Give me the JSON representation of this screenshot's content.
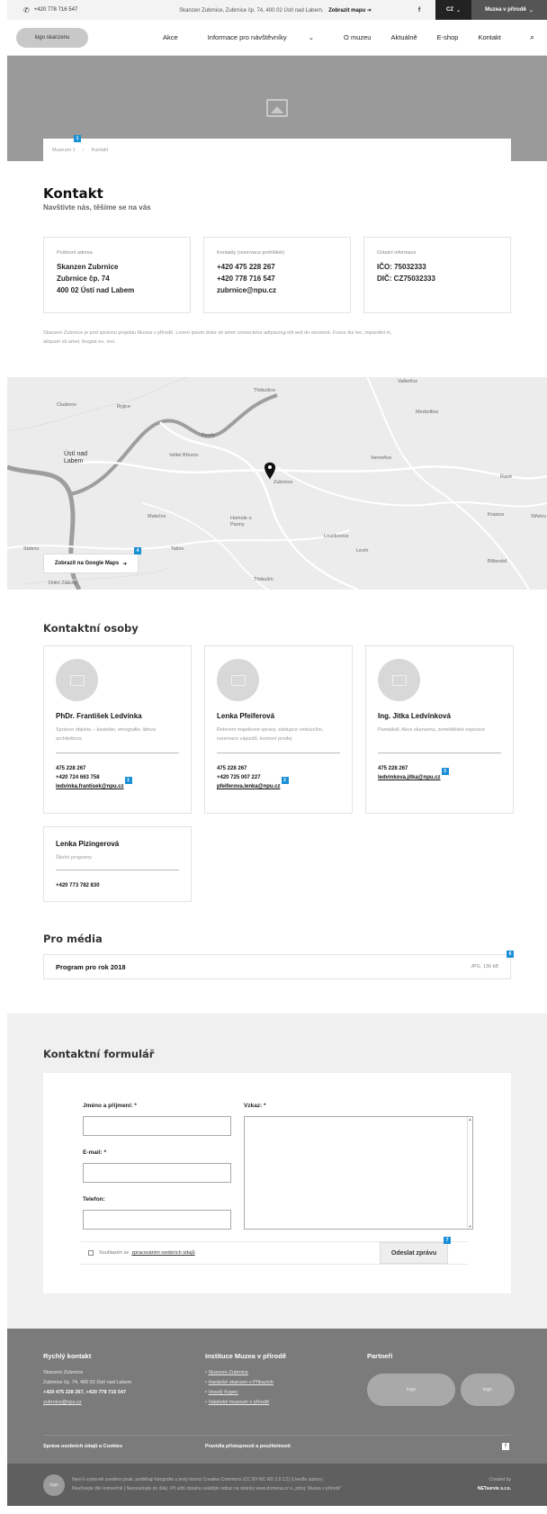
{
  "topbar": {
    "phone": "+420 778 716 547",
    "address": "Skanzen Zubrnice, Zubrnice čp. 74, 400 02 Ústí nad Labem.",
    "map_link": "Zobrazit mapu",
    "facebook": "f",
    "lang": "CZ",
    "museums": "Muzea v přírodě"
  },
  "nav": {
    "logo": "logo skanzenu",
    "items": [
      "Akce",
      "Informace pro návštěvníky",
      "O muzeu",
      "Aktuálně",
      "E-shop",
      "Kontakt"
    ]
  },
  "breadcrumb": {
    "home": "Muzeum 1",
    "current": "Kontakt"
  },
  "page": {
    "title": "Kontakt",
    "subtitle": "Navštivte nás, těšíme se na vás"
  },
  "info": [
    {
      "label": "Poštovní adresa",
      "lines": [
        "Skanzen Zubrnice",
        "Zubrnice čp. 74",
        "400 02 Ústí nad Labem"
      ]
    },
    {
      "label": "Kontakty (rezervace prohlídek)",
      "lines": [
        "+420 475 228 267",
        "+420 778 716 547",
        "zubrnice@npu.cz"
      ]
    },
    {
      "label": "Ostatní informace",
      "lines": [
        "IČO: 75032333",
        "DIČ: CZ75032333"
      ]
    }
  ],
  "note": "Skanzen Zubrnice je pod správou projektu Muzea v přírodě. Lorem ipsum dolor sit amet consectetur adipiscing elit sed do eiusmod. Fusce dui leo, imperdiet in, aliquam sit amet, feugiat eu, orci.",
  "map": {
    "labels": [
      "Třebušice",
      "Valkeřice",
      "Cluderov",
      "Ryjice",
      "Merboltice",
      "Povrly",
      "Ústí nad Labem",
      "Velké Březno",
      "Verneřice",
      "Zubrnice",
      "Malečov",
      "Homole u Panny",
      "Řané",
      "Krasice",
      "Střelov",
      "Loučkovice",
      "Levín",
      "Stebno",
      "Tašov",
      "Bílkevěd",
      "Dolní Zálezly",
      "Třebušín"
    ],
    "button": "Zobrazit na Google Maps"
  },
  "persons_title": "Kontaktní osoby",
  "persons": [
    {
      "name": "PhDr. František Ledvinka",
      "role": "Správce objektu – kastelán, etnografie, lidová architektura",
      "phones": [
        "475 228 267",
        "+420 724 663 758"
      ],
      "email": "ledvinka.frantisek@npu.cz"
    },
    {
      "name": "Lenka Pfeiferová",
      "role": "Referent majetkové správy, zástupce vedoucího, rezervace zájezdů, komisní prodej",
      "phones": [
        "475 228 267",
        "+420 725 007 227"
      ],
      "email": "pfeiferova.lenka@npu.cz"
    },
    {
      "name": "Ing. Jitka Ledvinková",
      "role": "Památkář, Akce skanzenu, zemědělské expozice",
      "phones": [
        "475 228 267"
      ],
      "email": "ledvinkova.jitka@npu.cz"
    },
    {
      "name": "Lenka Pizingerová",
      "role": "Školní programy",
      "phones": [
        "+420 773 782 830"
      ],
      "email": ""
    }
  ],
  "media": {
    "title": "Pro média",
    "item": "Program pro rok 2018",
    "size": "JPG, 136 kB"
  },
  "form": {
    "title": "Kontaktní formulář",
    "name_label": "Jméno a příjmení: *",
    "email_label": "E-mail: *",
    "phone_label": "Telefon:",
    "message_label": "Vzkaz: *",
    "consent_text": "Souhlasím se",
    "consent_link": "zpracováním osobních údajů",
    "submit": "Odeslat zprávu"
  },
  "footer": {
    "quick_title": "Rychlý kontakt",
    "quick_lines": [
      "Skanzen Zubrnice",
      "Zubrnice čp. 74, 400 02 Ústí nad Labem"
    ],
    "quick_phones": "+420 475 228 267, +420 778 716 547",
    "quick_email": "zubrnice@npu.cz",
    "inst_title": "Instituce Muzea v přírodě",
    "inst_links": [
      "Skanzen Zubrnice",
      "Hanácké skanzen v Příkazích",
      "Veselý Kopec",
      "Valašské muzeum v přírodě"
    ],
    "partners_title": "Partneři",
    "partner_logo": "logo",
    "privacy": "Správa osobních údajů a Cookies",
    "accessibility": "Pravidla přístupnosti a použitelnosti",
    "bottom_logo": "logo",
    "license1": "Není-li výslovně uvedeno jinak, podléhají fotografie a texty licenci Creative Commons (CC BY-NC-ND 3.0 CZ) (Uveďte autora |",
    "license2": "Neužívejte dílo komerčně | Nezasahujte do díla). Při užití obsahu uvádějte odkaz na stránky www.domena.cz a „zdroj: Muzea v přírodě\"",
    "created_by": "Created by",
    "creator": "NETservis s.r.o."
  },
  "badges": [
    "1",
    "4",
    "1",
    "2",
    "3",
    "6",
    "7"
  ]
}
